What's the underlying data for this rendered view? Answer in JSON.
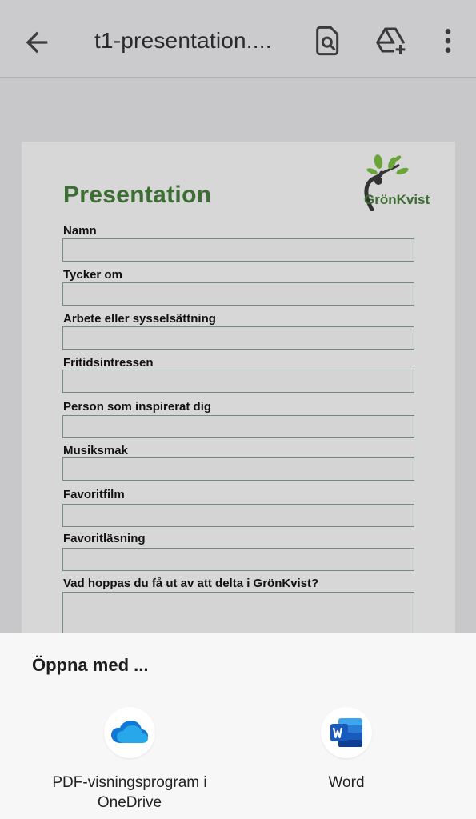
{
  "appbar": {
    "title": "t1-presentation....",
    "back_icon": "arrow-left-icon",
    "search_icon": "document-search-icon",
    "drive_icon": "drive-add-icon",
    "more_icon": "more-vert-icon"
  },
  "document": {
    "title": "Presentation",
    "logo_text": "GrönKvist",
    "fields": [
      {
        "label": "Namn"
      },
      {
        "label": "Tycker om"
      },
      {
        "label": "Arbete eller sysselsättning"
      },
      {
        "label": "Fritidsintressen"
      },
      {
        "label": "Person som inspirerat dig"
      },
      {
        "label": "Musiksmak"
      },
      {
        "label": "Favoritfilm"
      },
      {
        "label": "Favoritläsning"
      },
      {
        "label": "Vad hoppas du få ut av att delta i GrönKvist?"
      }
    ]
  },
  "sheet": {
    "title": "Öppna med ...",
    "apps": [
      {
        "label_line1": "PDF-visningsprogram i",
        "label_line2": "OneDrive",
        "icon": "onedrive-icon"
      },
      {
        "label_line1": "Word",
        "label_line2": "",
        "icon": "word-icon"
      }
    ]
  },
  "colors": {
    "brand_green": "#3c6d33",
    "onedrive_blue": "#0f78d4",
    "word_blue": "#185abd"
  }
}
